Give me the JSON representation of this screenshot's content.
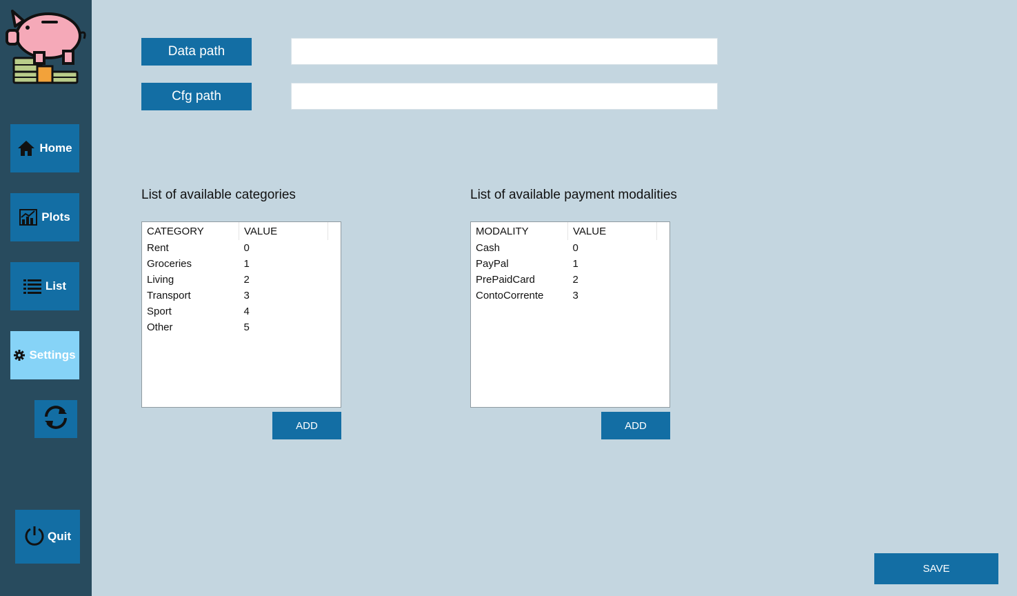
{
  "sidebar": {
    "items": [
      {
        "label": "Home",
        "icon": "home-icon"
      },
      {
        "label": "Plots",
        "icon": "chart-icon"
      },
      {
        "label": "List",
        "icon": "list-icon"
      },
      {
        "label": "Settings",
        "icon": "gear-icon",
        "active": true
      }
    ],
    "refresh_icon": "refresh-icon",
    "quit_label": "Quit",
    "quit_icon": "power-icon",
    "logo_icon": "piggy-bank-icon"
  },
  "paths": {
    "data_label": "Data path",
    "data_value": "",
    "cfg_label": "Cfg path",
    "cfg_value": ""
  },
  "categories": {
    "title": "List of available categories",
    "headers": [
      "CATEGORY",
      "VALUE"
    ],
    "rows": [
      [
        "Rent",
        "0"
      ],
      [
        "Groceries",
        "1"
      ],
      [
        "Living",
        "2"
      ],
      [
        "Transport",
        "3"
      ],
      [
        "Sport",
        "4"
      ],
      [
        "Other",
        "5"
      ]
    ],
    "add_label": "ADD"
  },
  "modalities": {
    "title": "List of available payment modalities",
    "headers": [
      "MODALITY",
      "VALUE"
    ],
    "rows": [
      [
        "Cash",
        "0"
      ],
      [
        "PayPal",
        "1"
      ],
      [
        "PrePaidCard",
        "2"
      ],
      [
        "ContoCorrente",
        "3"
      ]
    ],
    "add_label": "ADD"
  },
  "save_label": "SAVE",
  "colors": {
    "background": "#c4d6e0",
    "sidebar": "#284b5e",
    "accent": "#136ea4",
    "active": "#86d3f7"
  }
}
